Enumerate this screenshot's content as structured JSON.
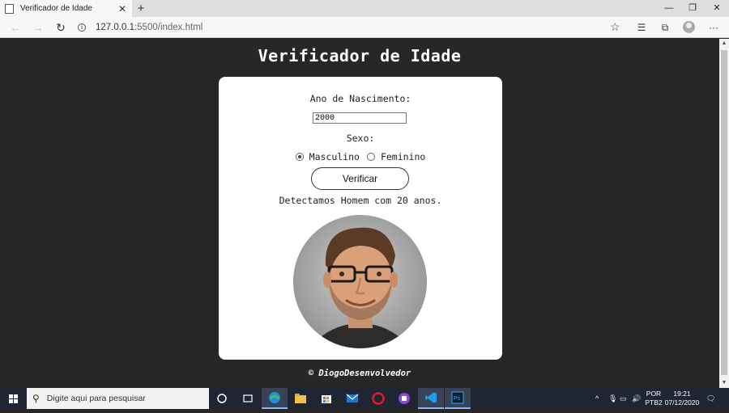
{
  "browser": {
    "tab_title": "Verificador de Idade",
    "new_tab_label": "+",
    "url_host": "127.0.0.1",
    "url_rest": ":5500/index.html"
  },
  "page": {
    "title": "Verificador de Idade",
    "ano_label": "Ano de Nascimento:",
    "ano_value": "2000",
    "sexo_label": "Sexo:",
    "sexo_options": [
      "Masculino",
      "Feminino"
    ],
    "sexo_selected": "Masculino",
    "button_label": "Verificar",
    "result_text": "Detectamos Homem com 20 anos.",
    "footer": "© DiogoDesenvolvedor"
  },
  "taskbar": {
    "search_placeholder": "Digite aqui para pesquisar",
    "lang_line1": "POR",
    "lang_line2": "PTB2",
    "time": "19:21",
    "date": "07/12/2020"
  },
  "colors": {
    "page_bg": "#282725",
    "card_bg": "#ffffff",
    "taskbar_bg": "#1f2533"
  }
}
